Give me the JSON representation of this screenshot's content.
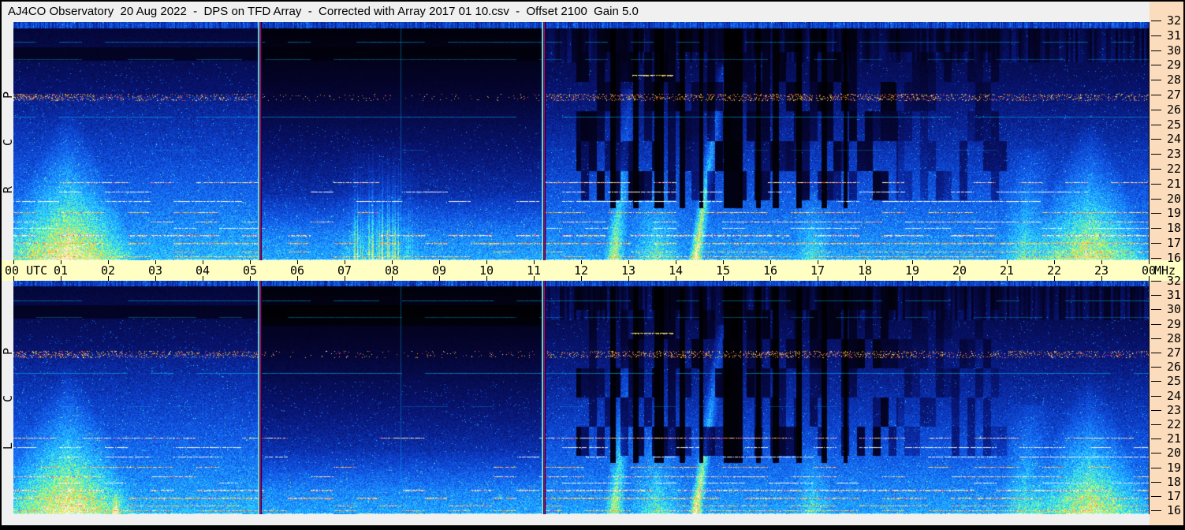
{
  "window": {
    "title": "AJ4CO Observatory  20 Aug 2022  -  DPS on TFD Array  -  Corrected with Array 2017 01 10.csv  -  Offset 2100  Gain 5.0"
  },
  "colors": {
    "chrome_bg": "#f0f0f0",
    "time_bar_bg": "#ffffc4",
    "freq_panel_bg": "#fbdcbc",
    "border": "#000000",
    "tick": "#000000"
  },
  "time_axis": {
    "labels": [
      "00 UTC",
      "01",
      "02",
      "03",
      "04",
      "05",
      "06",
      "07",
      "08",
      "09",
      "10",
      "11",
      "12",
      "13",
      "14",
      "15",
      "16",
      "17",
      "18",
      "19",
      "20",
      "21",
      "22",
      "23",
      "00"
    ],
    "unit_label": "MHz"
  },
  "freq_axis": {
    "ticks": [
      32,
      31,
      30,
      29,
      28,
      27,
      26,
      25,
      24,
      23,
      22,
      21,
      20,
      19,
      18,
      17,
      16
    ],
    "unit": "MHz"
  },
  "panels": [
    {
      "name": "RCP",
      "label": "R C P",
      "seed": 101
    },
    {
      "name": "LCP",
      "label": "L C P",
      "seed": 202
    }
  ],
  "chart_data": {
    "type": "heatmap",
    "subtype": "radio-spectrogram",
    "title": "AJ4CO Observatory  20 Aug 2022  -  DPS on TFD Array  -  Corrected with Array 2017 01 10.csv  -  Offset 2100  Gain 5.0",
    "observatory": "AJ4CO Observatory",
    "date": "20 Aug 2022",
    "instrument": "DPS on TFD Array",
    "correction_file": "Array 2017 01 10.csv",
    "offset": 2100,
    "gain": 5.0,
    "xlabel": "UTC",
    "ylabel": "MHz",
    "x_range_hours": [
      0,
      24
    ],
    "y_range_mhz": [
      16,
      32
    ],
    "x_tick_step_hours": 1,
    "y_tick_step_mhz": 1,
    "panel_names": [
      "RCP",
      "LCP"
    ],
    "segment_boundaries_utc": [
      5.217,
      11.217
    ],
    "render": {
      "colormap": [
        [
          0.0,
          [
            0,
            0,
            0
          ]
        ],
        [
          0.12,
          [
            4,
            4,
            46
          ]
        ],
        [
          0.25,
          [
            8,
            22,
            120
          ]
        ],
        [
          0.38,
          [
            12,
            64,
            205
          ]
        ],
        [
          0.5,
          [
            22,
            112,
            246
          ]
        ],
        [
          0.6,
          [
            30,
            165,
            255
          ]
        ],
        [
          0.7,
          [
            45,
            218,
            255
          ]
        ],
        [
          0.78,
          [
            95,
            245,
            185
          ]
        ],
        [
          0.85,
          [
            175,
            250,
            105
          ]
        ],
        [
          0.91,
          [
            238,
            242,
            80
          ]
        ],
        [
          0.96,
          [
            250,
            175,
            60
          ]
        ],
        [
          1.0,
          [
            255,
            240,
            225
          ]
        ]
      ],
      "wedges": [
        {
          "t": 1.15,
          "halfwidth_h": 1.5,
          "top_mhz": 26.5,
          "strength": 1.0
        },
        {
          "t": 22.75,
          "halfwidth_h": 1.35,
          "top_mhz": 26.0,
          "strength": 0.9
        }
      ],
      "fountain": {
        "t0": 6.85,
        "t1": 8.6,
        "top_mhz": 24.5,
        "strength": 1.0,
        "panels": [
          "RCP"
        ]
      },
      "bright_streaks": [
        {
          "t_at_16mhz": 12.7,
          "slope_h_per_mhz": 0.03,
          "width_h": 0.22,
          "top_mhz": 27.5,
          "strength": 0.6
        },
        {
          "t_at_16mhz": 14.42,
          "slope_h_per_mhz": 0.045,
          "width_h": 0.16,
          "top_mhz": 29.0,
          "strength": 0.85
        },
        {
          "t_at_16mhz": 13.6,
          "slope_h_per_mhz": 0,
          "width_h": 0.55,
          "top_mhz": 22.0,
          "strength": 0.35
        },
        {
          "t_at_16mhz": 16.9,
          "slope_h_per_mhz": 0,
          "width_h": 0.4,
          "top_mhz": 20.5,
          "strength": 0.28
        },
        {
          "t_at_16mhz": 21.35,
          "slope_h_per_mhz": 0.02,
          "width_h": 0.5,
          "top_mhz": 23.5,
          "strength": 0.35
        },
        {
          "t_at_16mhz": 2.17,
          "slope_h_per_mhz": 0,
          "width_h": 0.1,
          "top_mhz": 17.4,
          "strength": 0.6,
          "panels": [
            "LCP"
          ]
        }
      ],
      "dropout_bands_utc": [
        [
          12.62,
          12.74
        ],
        [
          13.1,
          13.22
        ],
        [
          13.55,
          13.75
        ],
        [
          14.08,
          14.2
        ],
        [
          14.5,
          14.58
        ],
        [
          15.02,
          15.42
        ],
        [
          15.7,
          15.8
        ],
        [
          16.05,
          16.18
        ],
        [
          16.55,
          16.66
        ],
        [
          17.08,
          17.2
        ],
        [
          17.55,
          17.64
        ]
      ],
      "dark_patch_region": {
        "t0": 11.9,
        "t1": 21.0,
        "f0": 20.0,
        "strong_until": 18.7
      },
      "dark_band": {
        "f0": 29.4,
        "f1": 30.3,
        "factor": 0.55
      },
      "lcp_dark_band": {
        "f0": 28.9,
        "f1": 30.3,
        "factor": 0.35
      },
      "rfi_band_27": {
        "f0": 26.75,
        "f1": 27.2,
        "density_by_section": [
          0.42,
          0.1,
          0.45
        ]
      },
      "rfi_lines": [
        {
          "mhz": 30.65,
          "style": "cyan",
          "coverage": [
            0.75,
            0.75,
            0.75
          ],
          "alpha": 0.55,
          "thickness": 1
        },
        {
          "mhz": 29.5,
          "style": "cyan",
          "coverage": [
            0.6,
            0.6,
            0.6
          ],
          "alpha": 0.4,
          "thickness": 1
        },
        {
          "mhz": 25.65,
          "style": "cyan",
          "coverage": [
            0.95,
            0.95,
            0.95
          ],
          "alpha": 0.6,
          "thickness": 1
        },
        {
          "mhz": 23.4,
          "style": "cyan",
          "coverage": [
            0.3,
            0.2,
            0.3
          ],
          "alpha": 0.3,
          "thickness": 1
        },
        {
          "mhz": 21.25,
          "style": "multi",
          "coverage": [
            0.75,
            0.12,
            0.65
          ],
          "thickness": 1
        },
        {
          "mhz": 20.6,
          "style": "white",
          "coverage": [
            0.45,
            0.08,
            0.45
          ],
          "thickness": 1
        },
        {
          "mhz": 19.95,
          "style": "white",
          "coverage": [
            0.55,
            0.1,
            0.55
          ],
          "thickness": 1
        },
        {
          "mhz": 19.25,
          "style": "warm",
          "coverage": [
            0.45,
            0.12,
            0.6
          ],
          "thickness": 1
        },
        {
          "mhz": 18.6,
          "style": "multi",
          "coverage": [
            0.5,
            0.18,
            0.65
          ],
          "thickness": 1
        },
        {
          "mhz": 18.15,
          "style": "white",
          "coverage": [
            0.4,
            0.1,
            0.55
          ],
          "thickness": 1
        },
        {
          "mhz": 17.7,
          "style": "multi",
          "coverage": [
            0.75,
            0.45,
            0.75
          ],
          "thickness": 2
        },
        {
          "mhz": 17.15,
          "style": "warm",
          "coverage": [
            0.8,
            0.55,
            0.8
          ],
          "thickness": 2
        },
        {
          "mhz": 16.6,
          "style": "warm",
          "coverage": [
            0.55,
            0.3,
            0.65
          ],
          "thickness": 1
        },
        {
          "mhz": 16.25,
          "style": "warm",
          "coverage": [
            0.65,
            0.35,
            0.75
          ],
          "thickness": 1
        },
        {
          "mhz": 16.05,
          "style": "bright",
          "coverage": [
            0.95,
            0.95,
            0.95
          ],
          "thickness": 1
        }
      ],
      "rfi_segments": [
        {
          "mhz": 28.45,
          "t0": 13.05,
          "t1": 13.95,
          "style": "yellow-white",
          "thickness": 2
        }
      ],
      "vlines": [
        {
          "t": 8.18,
          "color": [
            0,
            180,
            255
          ],
          "alpha": 0.4
        }
      ],
      "divider_colors": {
        "cyan": [
          0,
          225,
          255
        ],
        "white": [
          255,
          255,
          255
        ],
        "black": [
          0,
          0,
          0
        ],
        "magenta": [
          220,
          0,
          185
        ]
      }
    }
  }
}
